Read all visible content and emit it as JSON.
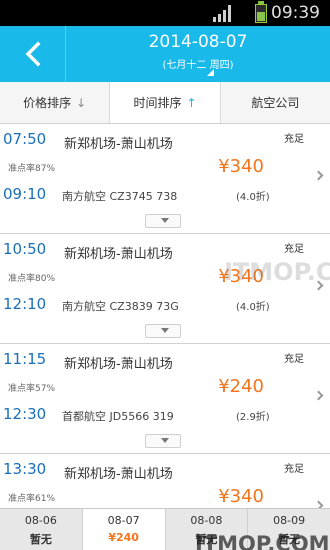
{
  "status_bar": {
    "time": "09:39"
  },
  "header": {
    "date": "2014-08-07",
    "lunar": "(七月十二 周四)"
  },
  "sort_tabs": [
    {
      "label": "价格排序",
      "arrow": "↓"
    },
    {
      "label": "时间排序",
      "arrow": "↑"
    },
    {
      "label": "航空公司",
      "arrow": ""
    }
  ],
  "flights": [
    {
      "dep": "07:50",
      "arr": "09:10",
      "route": "新郑机场-萧山机场",
      "seats": "充足",
      "ontime": "准点率87%",
      "price": "¥340",
      "airline": "南方航空 CZ3745 738",
      "discount": "(4.0折)"
    },
    {
      "dep": "10:50",
      "arr": "12:10",
      "route": "新郑机场-萧山机场",
      "seats": "充足",
      "ontime": "准点率80%",
      "price": "¥340",
      "airline": "南方航空 CZ3839 73G",
      "discount": "(4.0折)"
    },
    {
      "dep": "11:15",
      "arr": "12:30",
      "route": "新郑机场-萧山机场",
      "seats": "充足",
      "ontime": "准点率57%",
      "price": "¥240",
      "airline": "首都航空 JD5566 319",
      "discount": "(2.9折)"
    },
    {
      "dep": "13:30",
      "arr": "",
      "route": "新郑机场-萧山机场",
      "seats": "充足",
      "ontime": "准点率61%",
      "price": "¥340",
      "airline": "",
      "discount": ""
    }
  ],
  "date_tabs": [
    {
      "date": "08-06",
      "price": "暂无"
    },
    {
      "date": "08-07",
      "price": "¥240"
    },
    {
      "date": "08-08",
      "price": "暂无"
    },
    {
      "date": "08-09",
      "price": "暂无"
    }
  ],
  "watermark": "ITMOP.COM",
  "colors": {
    "header": "#19b9e9",
    "price": "#f3751c",
    "time": "#1a6fb8"
  }
}
